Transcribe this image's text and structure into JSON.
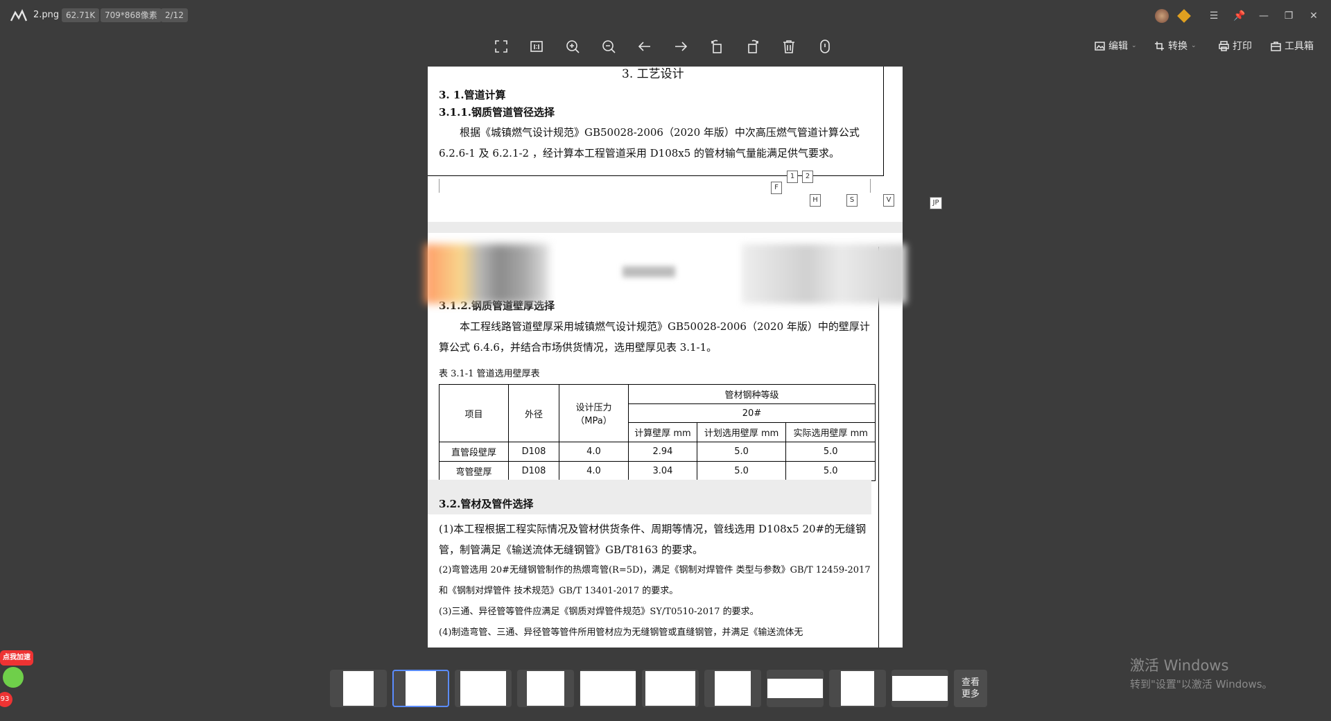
{
  "file": {
    "name": "2.png",
    "size": "62.71K",
    "dimensions": "709*868像素",
    "page": "2/12"
  },
  "toolbar_right": {
    "edit": "编辑",
    "convert": "转换",
    "print": "打印",
    "tools": "工具箱"
  },
  "doc": {
    "section_title": "3. 工艺设计",
    "h_311_parent": "3. 1.管道计算",
    "h_311": "3.1.1.钢质管道管径选择",
    "p_311": "根据《城镇燃气设计规范》GB50028-2006（2020 年版）中次高压燃气管道计算公式 6.2.6-1 及 6.2.1-2 ，经计算本工程管道采用 D108x5 的管材输气量能满足供气要求。",
    "markers": [
      "1",
      "2",
      "F",
      "H",
      "S",
      "V",
      "JP"
    ],
    "h_312": "3.1.2.钢质管道壁厚选择",
    "p_312": "本工程线路管道壁厚采用城镇燃气设计规范》GB50028-2006（2020 年版）中的壁厚计算公式 6.4.6，并结合市场供货情况，选用壁厚见表 3.1-1。",
    "table_caption": "表 3.1-1  管道选用壁厚表",
    "table": {
      "h_item": "项目",
      "h_od": "外径",
      "h_pressure": "设计压力（MPa）",
      "h_grade": "管材钢种等级",
      "grade": "20#",
      "h_calc": "计算壁厚 mm",
      "h_plan": "计划选用壁厚 mm",
      "h_actual": "实际选用壁厚 mm",
      "rows": [
        {
          "item": "直管段壁厚",
          "od": "D108",
          "pressure": "4.0",
          "calc": "2.94",
          "plan": "5.0",
          "actual": "5.0"
        },
        {
          "item": "弯管壁厚",
          "od": "D108",
          "pressure": "4.0",
          "calc": "3.04",
          "plan": "5.0",
          "actual": "5.0"
        }
      ]
    },
    "h_32": "3.2.管材及管件选择",
    "p_32_1": "(1)本工程根据工程实际情况及管材供货条件、周期等情况，管线选用 D108x5  20#的无缝钢管，制管满足《输送流体无缝钢管》GB/T8163 的要求。",
    "p_32_2": "(2)弯管选用 20#无缝钢管制作的热煨弯管(R=5D)，满足《钢制对焊管件 类型与参数》GB/T 12459-2017 和《钢制对焊管件 技术规范》GB/T 13401-2017 的要求。",
    "p_32_3": "(3)三通、异径管等管件应满足《钢质对焊管件规范》SY/T0510-2017 的要求。",
    "p_32_4": "(4)制造弯管、三通、异径管等管件所用管材应为无缝钢管或直缝钢管，并满足《输送流体无"
  },
  "thumbnails": {
    "count": 10,
    "active_index": 1,
    "more_label_1": "查看",
    "more_label_2": "更多"
  },
  "overlay": {
    "badge_text": "点我加速",
    "badge_count": "93"
  },
  "watermark": {
    "line1": "激活 Windows",
    "line2": "转到\"设置\"以激活 Windows。"
  },
  "colors": {
    "background": "#3c3c3c",
    "accent": "#5b8cff"
  }
}
